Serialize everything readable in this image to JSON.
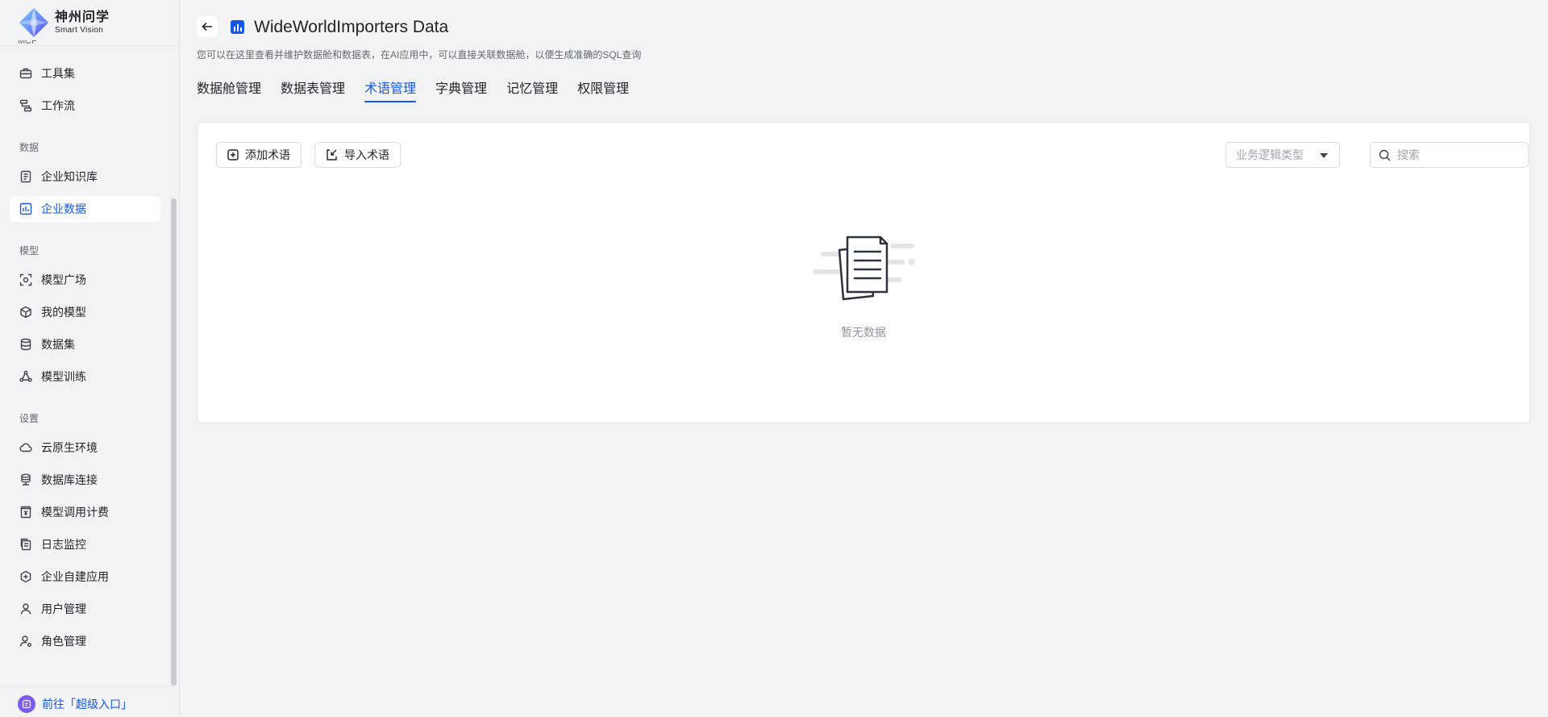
{
  "brand": {
    "name_cn": "神州问学",
    "name_en": "Smart Vision"
  },
  "sidebar": {
    "clipped_label": "MCP",
    "items_top": [
      {
        "label": "工具集",
        "icon": "toolbox-icon"
      },
      {
        "label": "工作流",
        "icon": "workflow-icon"
      }
    ],
    "sections": [
      {
        "title": "数据",
        "items": [
          {
            "label": "企业知识库",
            "icon": "knowledge-base-icon"
          },
          {
            "label": "企业数据",
            "icon": "bar-chart-icon",
            "active": true
          }
        ]
      },
      {
        "title": "模型",
        "items": [
          {
            "label": "模型广场",
            "icon": "model-square-icon"
          },
          {
            "label": "我的模型",
            "icon": "cube-icon"
          },
          {
            "label": "数据集",
            "icon": "database-icon"
          },
          {
            "label": "模型训练",
            "icon": "training-icon"
          }
        ]
      },
      {
        "title": "设置",
        "items": [
          {
            "label": "云原生环境",
            "icon": "cloud-icon"
          },
          {
            "label": "数据库连接",
            "icon": "db-connection-icon"
          },
          {
            "label": "模型调用计费",
            "icon": "billing-icon"
          },
          {
            "label": "日志监控",
            "icon": "log-icon"
          },
          {
            "label": "企业自建应用",
            "icon": "app-icon"
          },
          {
            "label": "用户管理",
            "icon": "user-icon"
          },
          {
            "label": "角色管理",
            "icon": "role-icon"
          }
        ]
      }
    ],
    "bottom_link": "前往「超级入口」"
  },
  "header": {
    "title": "WideWorldImporters Data",
    "subtitle": "您可以在这里查看并维护数据舱和数据表，在AI应用中，可以直接关联数据舱，以便生成准确的SQL查询"
  },
  "tabs": [
    {
      "label": "数据舱管理"
    },
    {
      "label": "数据表管理"
    },
    {
      "label": "术语管理",
      "active": true
    },
    {
      "label": "字典管理"
    },
    {
      "label": "记忆管理"
    },
    {
      "label": "权限管理"
    }
  ],
  "toolbar": {
    "add_label": "添加术语",
    "import_label": "导入术语",
    "type_select_placeholder": "业务逻辑类型",
    "search_placeholder": "搜索"
  },
  "empty": {
    "text": "暂无数据"
  },
  "colors": {
    "accent": "#1456f0",
    "bottom_badge": "#7b5cf0"
  }
}
